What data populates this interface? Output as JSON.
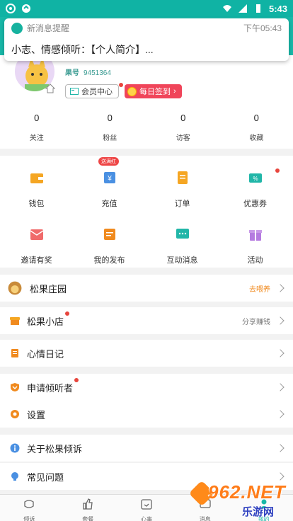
{
  "status_bar": {
    "time": "5:43"
  },
  "notification": {
    "title": "新消息提醒",
    "time": "下午05:43",
    "body": "小志、情感倾听：【个人简介】..."
  },
  "profile": {
    "uid_label": "果号",
    "uid": "9451364",
    "member_label": "会员中心",
    "sign_label": "每日签到"
  },
  "stats": [
    {
      "value": "0",
      "label": "关注"
    },
    {
      "value": "0",
      "label": "粉丝"
    },
    {
      "value": "0",
      "label": "访客"
    },
    {
      "value": "0",
      "label": "收藏"
    }
  ],
  "grid": {
    "recharge_tag": "送满红",
    "items": [
      {
        "label": "钱包",
        "icon": "wallet-icon",
        "color": "#f5a623"
      },
      {
        "label": "充值",
        "icon": "recharge-icon",
        "color": "#4a90e2"
      },
      {
        "label": "订单",
        "icon": "order-icon",
        "color": "#f5a623"
      },
      {
        "label": "优惠券",
        "icon": "coupon-icon",
        "color": "#21b6a8"
      },
      {
        "label": "邀请有奖",
        "icon": "invite-icon",
        "color": "#f06b6b"
      },
      {
        "label": "我的发布",
        "icon": "publish-icon",
        "color": "#f08a1e"
      },
      {
        "label": "互动消息",
        "icon": "message-icon",
        "color": "#21b6a8"
      },
      {
        "label": "活动",
        "icon": "gift-icon",
        "color": "#b57be0"
      }
    ]
  },
  "rows": [
    {
      "label": "松果庄园",
      "hint": "去喂养",
      "icon": "manor-icon"
    },
    {
      "label": "松果小店",
      "hint": "分享赚钱",
      "icon": "shop-icon"
    },
    {
      "label": "心情日记",
      "hint": "",
      "icon": "diary-icon"
    },
    {
      "label": "申请倾听者",
      "hint": "",
      "icon": "listener-icon"
    },
    {
      "label": "设置",
      "hint": "",
      "icon": "settings-icon"
    },
    {
      "label": "关于松果倾诉",
      "hint": "",
      "icon": "info-icon"
    },
    {
      "label": "常见问题",
      "hint": "",
      "icon": "faq-icon"
    }
  ],
  "bottom_nav": [
    {
      "label": "倾诉",
      "icon": "talk-icon"
    },
    {
      "label": "套餐",
      "icon": "thumb-icon"
    },
    {
      "label": "心事",
      "icon": "calendar-icon"
    },
    {
      "label": "消息",
      "icon": "message-nav-icon"
    },
    {
      "label": "我的",
      "icon": "me-icon"
    }
  ],
  "watermark": {
    "big": "962.NET",
    "small": "乐游网"
  },
  "colors": {
    "primary": "#18b8a8",
    "accent_red": "#f0455a",
    "hint_orange": "#f08a1e"
  }
}
